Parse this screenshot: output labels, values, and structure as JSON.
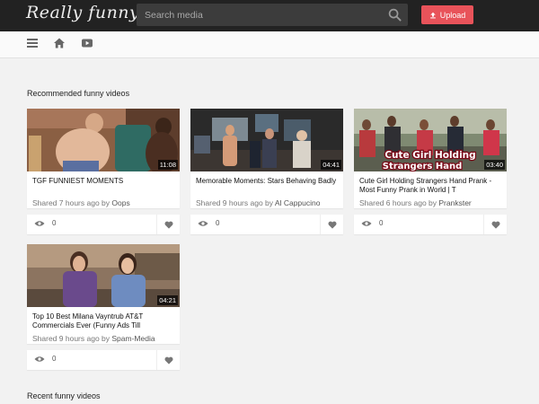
{
  "header": {
    "logo_text": "Really funny",
    "search_placeholder": "Search media",
    "upload_label": "Upload"
  },
  "nav": {
    "icons": [
      "menu-icon",
      "home-icon",
      "video-icon"
    ]
  },
  "sections": {
    "recommended_title": "Recommended funny videos",
    "recent_title": "Recent funny videos"
  },
  "videos": [
    {
      "title": "TGF FUNNIEST MOMENTS",
      "duration": "11:08",
      "shared": "Shared 7 hours ago by ",
      "author": "Oops",
      "views": "0"
    },
    {
      "title": "Memorable Moments: Stars Behaving Badly",
      "duration": "04:41",
      "shared": "Shared 9 hours ago by ",
      "author": "Al Cappucino",
      "views": "0"
    },
    {
      "title": "Cute Girl Holding Strangers Hand Prank - Most Funny Prank in World | T",
      "duration": "03:40",
      "shared": "Shared 6 hours ago by ",
      "author": "Prankster",
      "views": "0",
      "thumb_caption_line1": "Cute Girl Holding",
      "thumb_caption_line2": "Strangers Hand"
    },
    {
      "title": "Top 10 Best Milana Vayntrub AT&T Commercials Ever (Funny Ads Till",
      "duration": "04:21",
      "shared": "Shared 9 hours ago by ",
      "author": "Spam-Media",
      "views": "0"
    }
  ],
  "colors": {
    "topbar": "#222222",
    "accent": "#e8535a",
    "page_bg": "#f2f2f2"
  }
}
